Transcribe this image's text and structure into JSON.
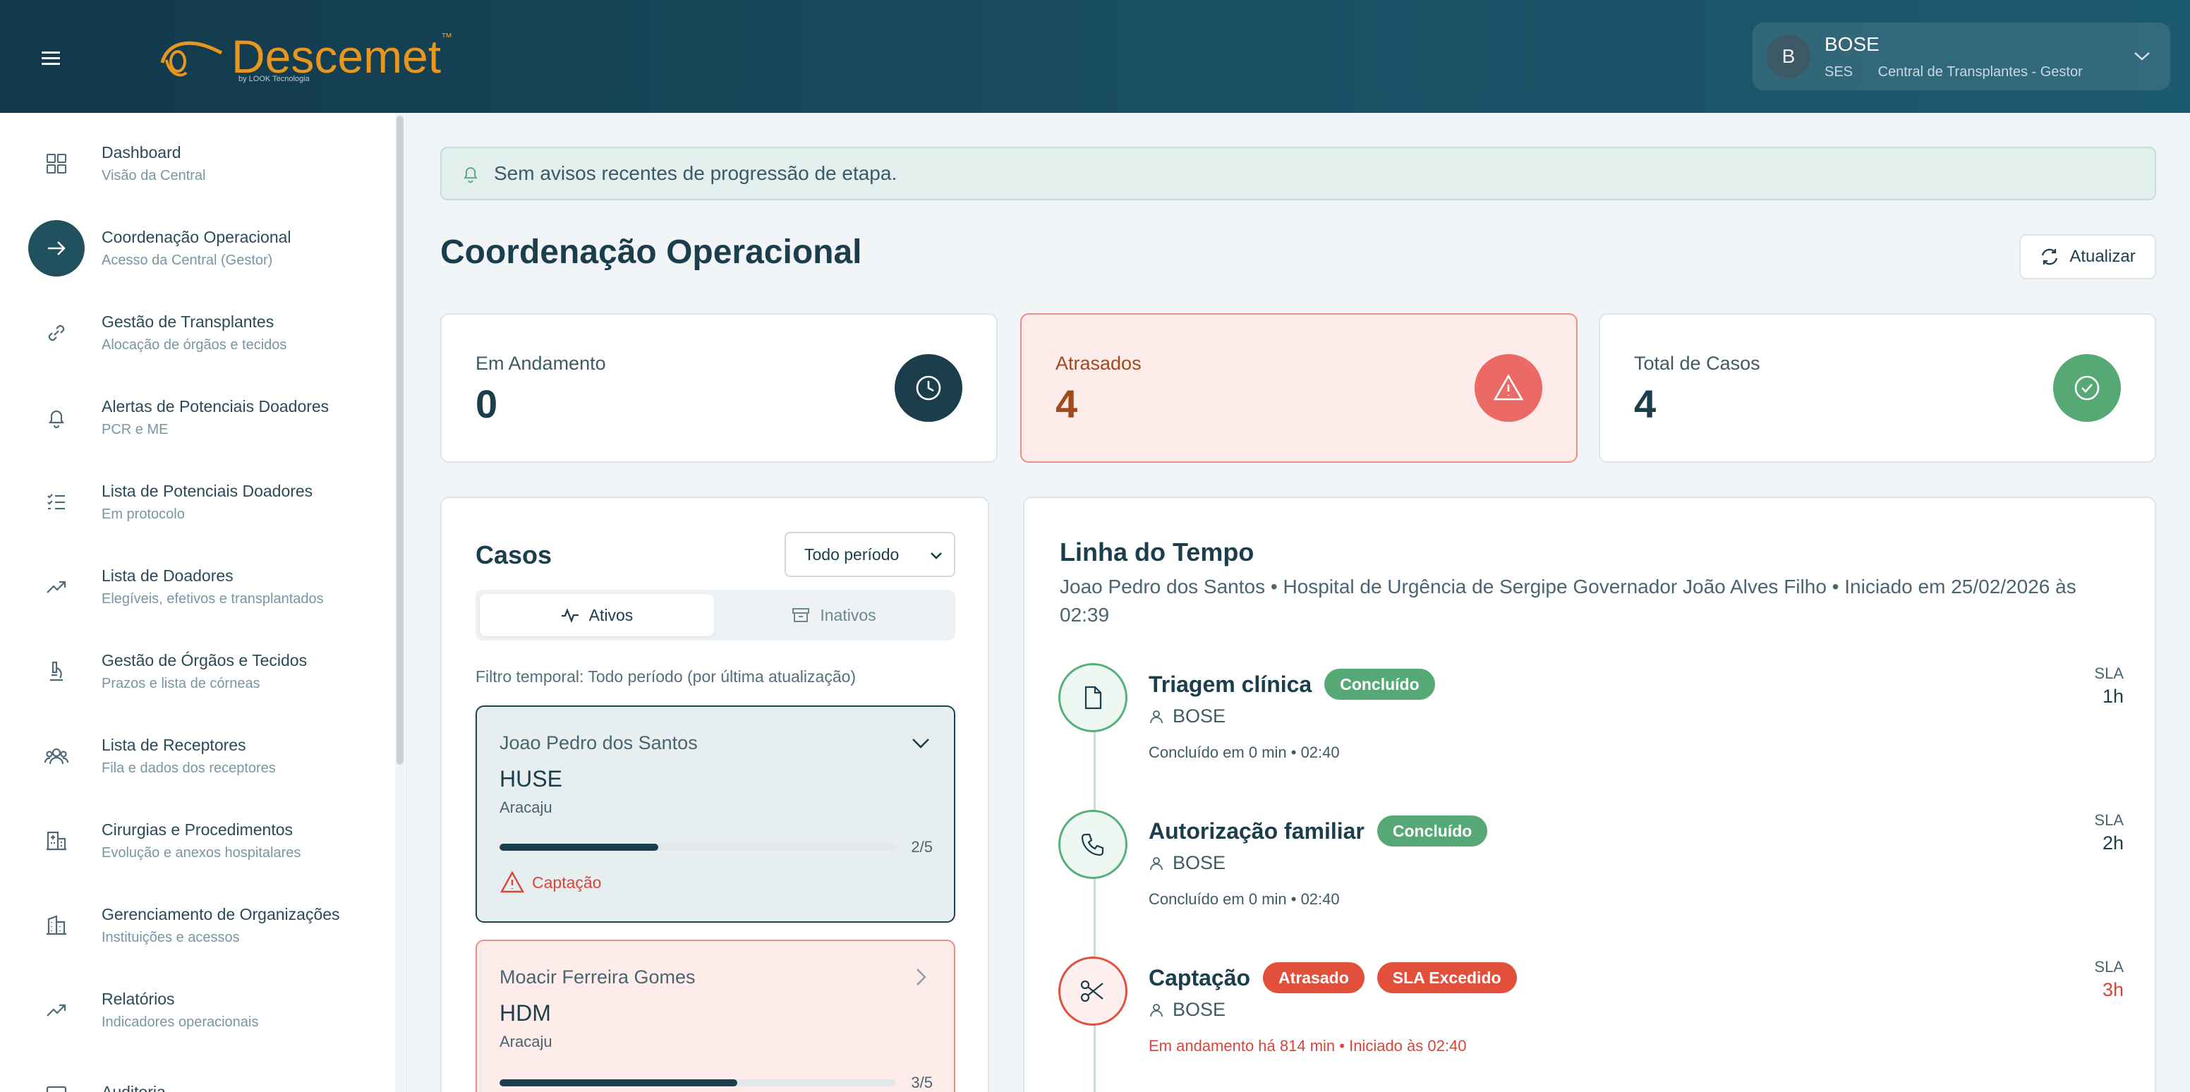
{
  "header": {
    "logo_text": "Descemet",
    "logo_tm": "™",
    "logo_sub": "by LOOK Tecnologia",
    "user": {
      "initial": "B",
      "name": "BOSE",
      "org": "SES",
      "role": "Central de Transplantes - Gestor"
    }
  },
  "sidebar": {
    "items": [
      {
        "title": "Dashboard",
        "sub": "Visão da Central",
        "icon": "grid-icon"
      },
      {
        "title": "Coordenação Operacional",
        "sub": "Acesso da Central (Gestor)",
        "icon": "arrow-right-icon",
        "active": true
      },
      {
        "title": "Gestão de Transplantes",
        "sub": "Alocação de órgãos e tecidos",
        "icon": "link-icon"
      },
      {
        "title": "Alertas de Potenciais Doadores",
        "sub": "PCR e ME",
        "icon": "bell-icon"
      },
      {
        "title": "Lista de Potenciais Doadores",
        "sub": "Em protocolo",
        "icon": "list-check-icon"
      },
      {
        "title": "Lista de Doadores",
        "sub": "Elegíveis, efetivos e transplantados",
        "icon": "trending-up-icon"
      },
      {
        "title": "Gestão de Órgãos e Tecidos",
        "sub": "Prazos e lista de córneas",
        "icon": "microscope-icon"
      },
      {
        "title": "Lista de Receptores",
        "sub": "Fila e dados dos receptores",
        "icon": "users-icon"
      },
      {
        "title": "Cirurgias e Procedimentos",
        "sub": "Evolução e anexos hospitalares",
        "icon": "hospital-icon"
      },
      {
        "title": "Gerenciamento de Organizações",
        "sub": "Instituições e acessos",
        "icon": "buildings-icon"
      },
      {
        "title": "Relatórios",
        "sub": "Indicadores operacionais",
        "icon": "trending-up-icon"
      },
      {
        "title": "Auditoria",
        "sub": "",
        "icon": "monitor-icon"
      }
    ]
  },
  "notice": {
    "text": "Sem avisos recentes de progressão de etapa."
  },
  "page": {
    "title": "Coordenação Operacional",
    "refresh_label": "Atualizar"
  },
  "stats": [
    {
      "label": "Em Andamento",
      "value": "0"
    },
    {
      "label": "Atrasados",
      "value": "4"
    },
    {
      "label": "Total de Casos",
      "value": "4"
    }
  ],
  "cases": {
    "title": "Casos",
    "period": "Todo período",
    "tabs": [
      {
        "label": "Ativos"
      },
      {
        "label": "Inativos"
      }
    ],
    "filter_text": "Filtro temporal: Todo período (por última atualização)",
    "list": [
      {
        "name": "Joao Pedro dos Santos",
        "hospital": "HUSE",
        "city": "Aracaju",
        "progress_text": "2/5",
        "progress": 0.4,
        "alert": "Captação"
      },
      {
        "name": "Moacir Ferreira Gomes",
        "hospital": "HDM",
        "city": "Aracaju",
        "progress_text": "3/5",
        "progress": 0.6
      }
    ]
  },
  "timeline": {
    "title": "Linha do Tempo",
    "subtitle": "Joao Pedro dos Santos • Hospital de Urgência de Sergipe Governador João Alves Filho • Iniciado em 25/02/2026 às 02:39",
    "sla_label": "SLA",
    "steps": [
      {
        "name": "Triagem clínica",
        "badges": [
          "Concluído"
        ],
        "user": "BOSE",
        "meta": "Concluído em 0 min • 02:40",
        "sla": "1h",
        "icon": "file-icon"
      },
      {
        "name": "Autorização familiar",
        "badges": [
          "Concluído"
        ],
        "user": "BOSE",
        "meta": "Concluído em 0 min • 02:40",
        "sla": "2h",
        "icon": "phone-icon"
      },
      {
        "name": "Captação",
        "badges": [
          "Atrasado",
          "SLA Excedido"
        ],
        "user": "BOSE",
        "meta": "Em andamento há 814 min • Iniciado às 02:40",
        "sla": "3h",
        "icon": "scissors-icon"
      }
    ]
  },
  "colors": {
    "brand_orange": "#e8961d",
    "accent_dark": "#1c3e4c",
    "success": "#56a874",
    "danger": "#e2503b"
  }
}
